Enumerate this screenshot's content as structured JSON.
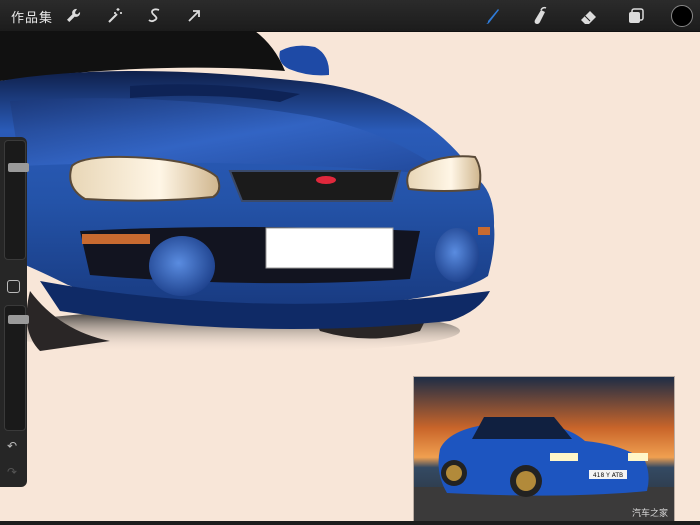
{
  "toolbar": {
    "gallery_label": "作品集",
    "left_tools": [
      "wrench-icon",
      "magic-wand-icon",
      "selection-icon",
      "transform-arrow-icon"
    ],
    "right_tools": [
      "brush-icon",
      "smudge-icon",
      "eraser-icon",
      "layers-icon"
    ],
    "active_tool": "brush-icon",
    "active_color": "#000000",
    "accent": "#2f7bd8"
  },
  "canvas": {
    "background": "#f8e6d8",
    "car_color": "#1f4fa8"
  },
  "reference": {
    "watermark": "汽车之家",
    "plate_text": "418 Y ATB"
  },
  "sidebar": {
    "brush_size_level": 0.2,
    "opacity_level": 0.06,
    "undo_icon": "undo-icon",
    "redo_icon": "redo-icon"
  }
}
